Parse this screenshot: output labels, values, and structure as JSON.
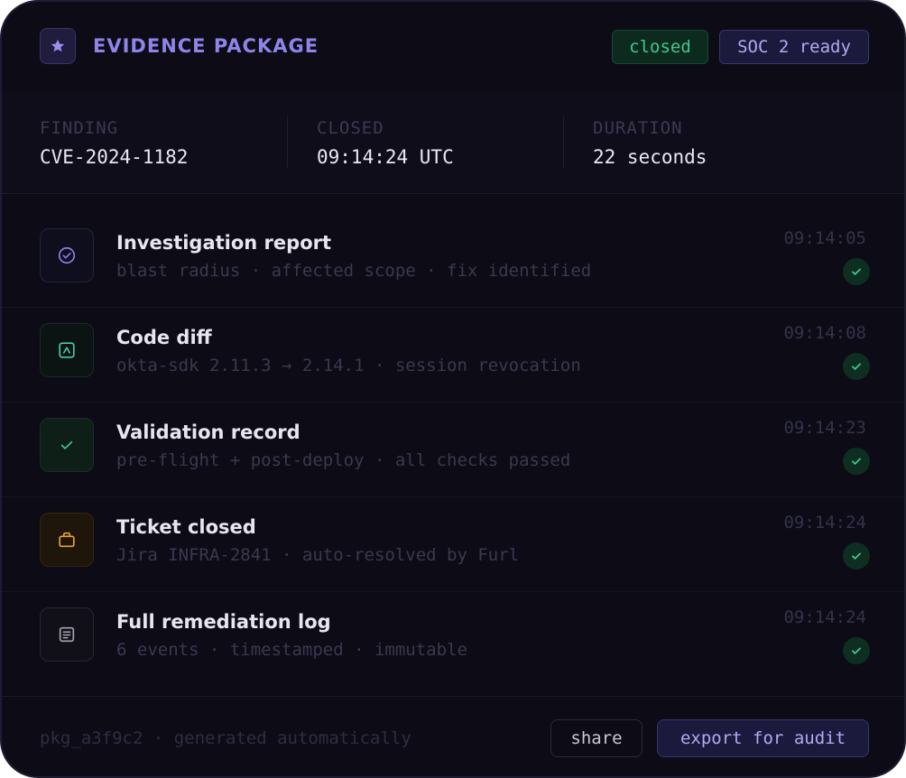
{
  "header": {
    "title": "EVIDENCE PACKAGE",
    "icon": "star-icon",
    "badges": {
      "status": "closed",
      "compliance": "SOC 2 ready"
    }
  },
  "summary": {
    "finding": {
      "label": "FINDING",
      "value": "CVE-2024-1182"
    },
    "closed": {
      "label": "CLOSED",
      "value": "09:14:24 UTC"
    },
    "duration": {
      "label": "DURATION",
      "value": "22 seconds"
    }
  },
  "items": [
    {
      "title": "Investigation report",
      "subtitle": "blast radius · affected scope · fix identified",
      "time": "09:14:05",
      "icon": "check-circle-icon",
      "status": "complete"
    },
    {
      "title": "Code diff",
      "subtitle": "okta-sdk 2.11.3 → 2.14.1 · session revocation",
      "time": "09:14:08",
      "icon": "code-box-icon",
      "status": "complete"
    },
    {
      "title": "Validation record",
      "subtitle": "pre-flight + post-deploy · all checks passed",
      "time": "09:14:23",
      "icon": "checkmark-icon",
      "status": "complete"
    },
    {
      "title": "Ticket closed",
      "subtitle": "Jira INFRA-2841 · auto-resolved by Furl",
      "time": "09:14:24",
      "icon": "briefcase-icon",
      "status": "complete"
    },
    {
      "title": "Full remediation log",
      "subtitle": "6 events · timestamped · immutable",
      "time": "09:14:24",
      "icon": "document-icon",
      "status": "complete"
    }
  ],
  "footer": {
    "package_info": "pkg_a3f9c2 · generated automatically",
    "share_label": "share",
    "export_label": "export for audit"
  },
  "colors": {
    "background": "#0c0b16",
    "accent": "#8f84ea",
    "success": "#3fc98a",
    "warning": "#e8a13a"
  }
}
